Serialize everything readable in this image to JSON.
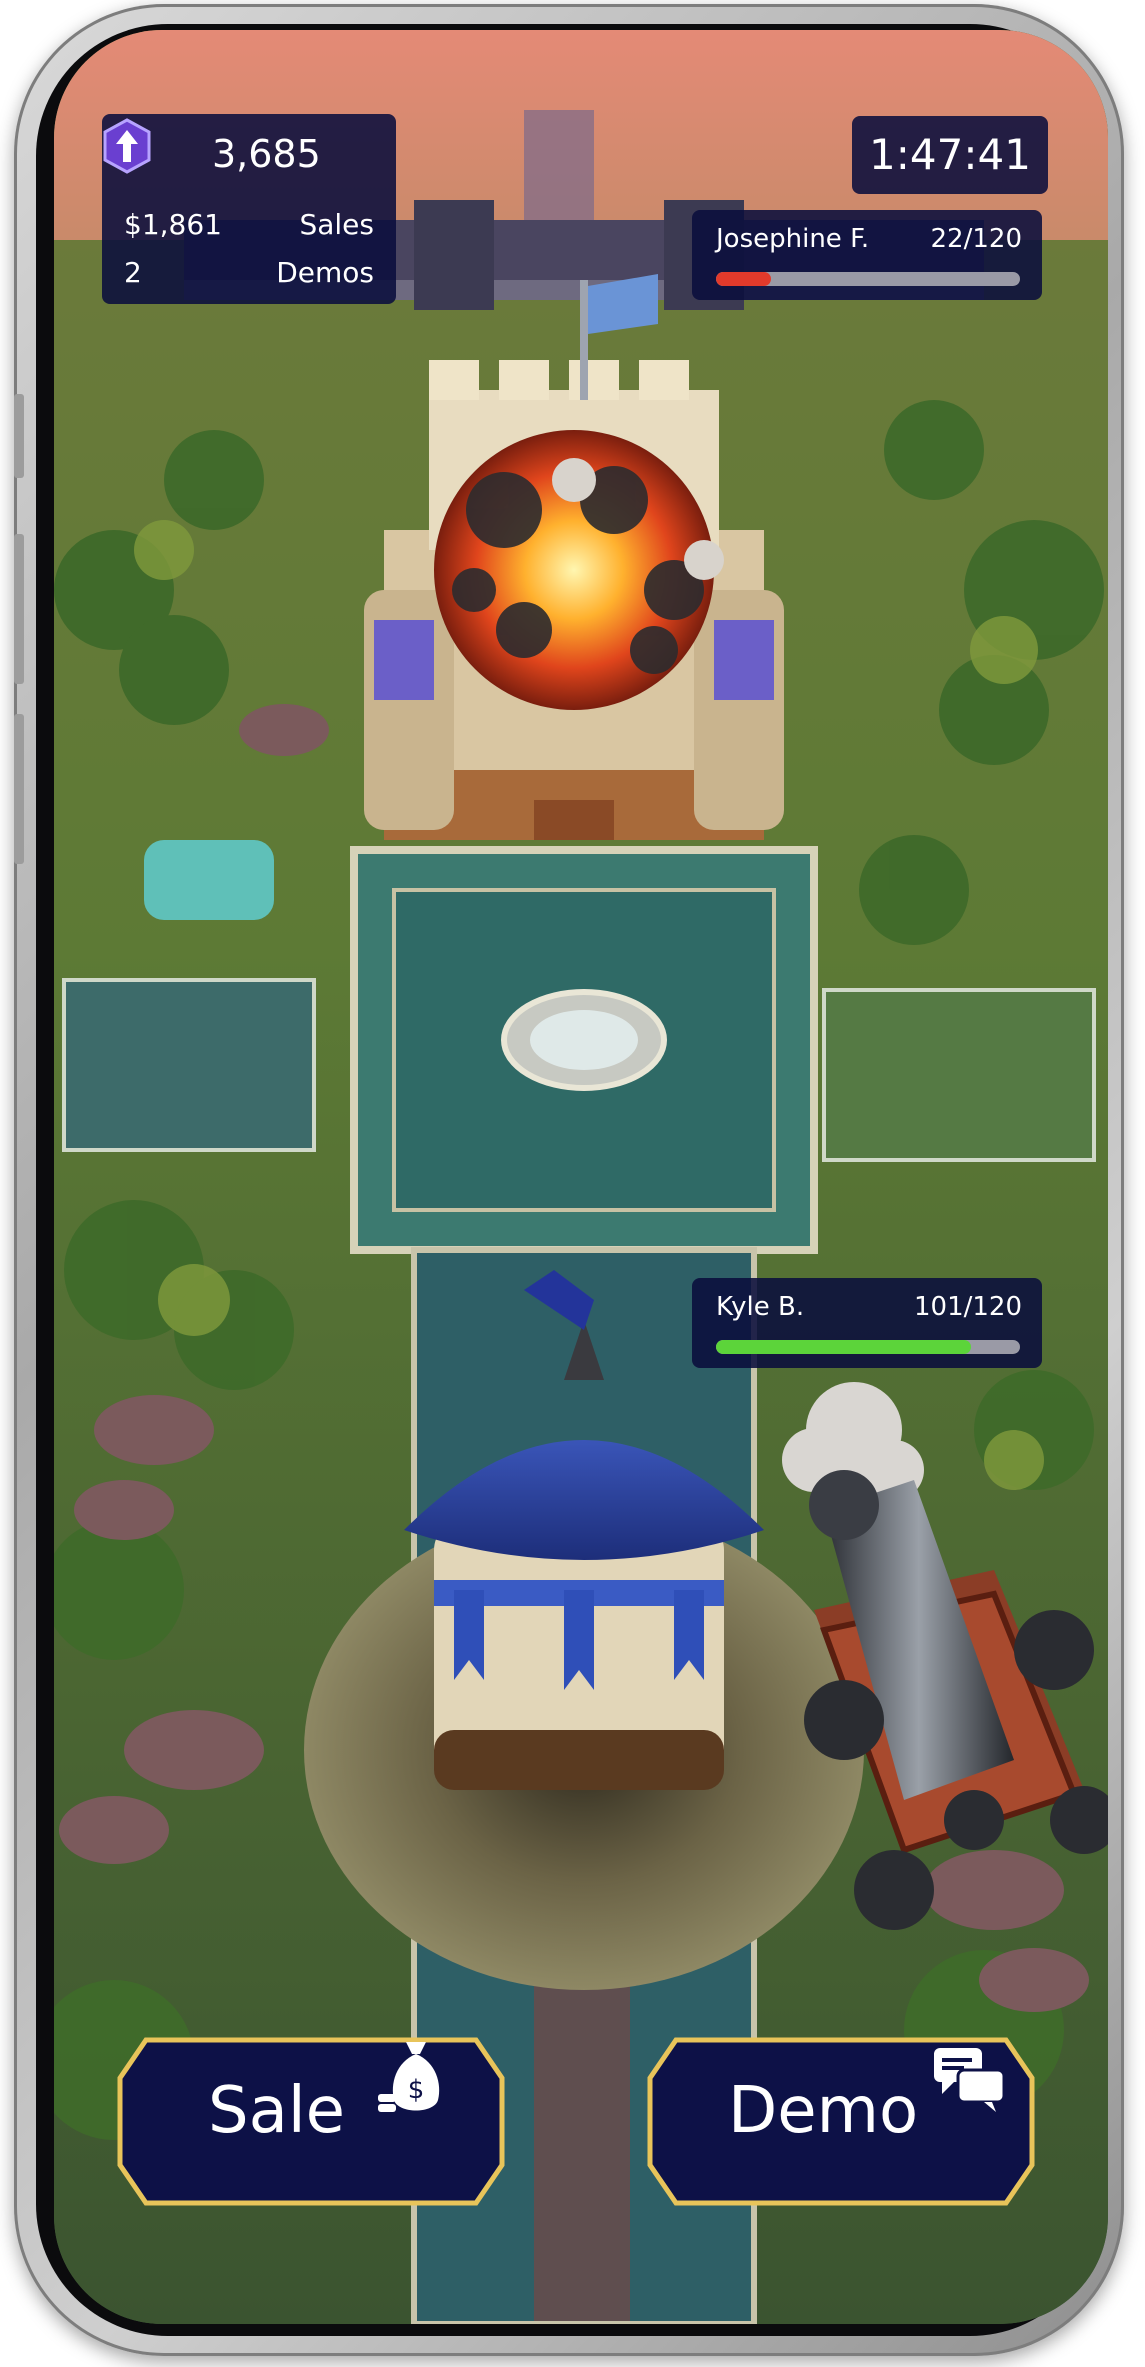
{
  "hud": {
    "points": "3,685",
    "sales_amount": "$1,861",
    "sales_label": "Sales",
    "demos_count": "2",
    "demos_label": "Demos",
    "timer": "1:47:41"
  },
  "opponent": {
    "name": "Josephine F.",
    "score": "22/120",
    "health_fraction": 0.18,
    "bar_color": "#e23a2b"
  },
  "player": {
    "name": "Kyle B.",
    "score": "101/120",
    "health_fraction": 0.84,
    "bar_color": "#5cd43a"
  },
  "actions": {
    "sale_label": "Sale",
    "sale_icon": "money-bag-icon",
    "demo_label": "Demo",
    "demo_icon": "chat-bubbles-icon"
  },
  "colors": {
    "panel_bg": "#0a0e3c",
    "button_border": "#e8c45a",
    "gem": "#6a3fd0"
  }
}
